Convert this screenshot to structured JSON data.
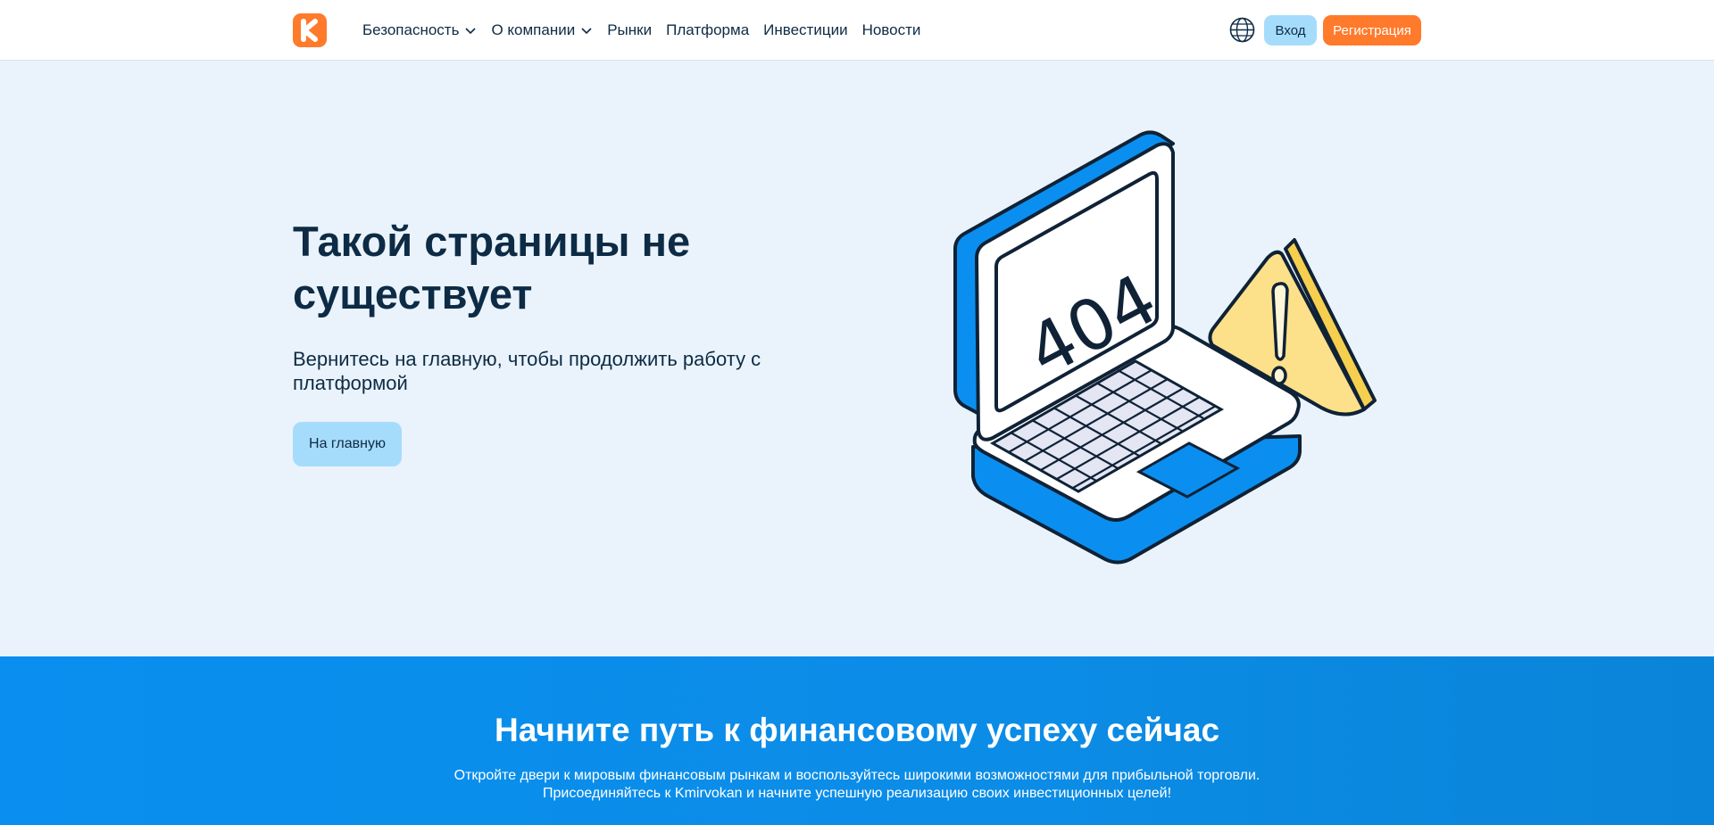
{
  "header": {
    "logo_icon": "brand-k-icon",
    "nav": [
      {
        "label": "Безопасность",
        "dropdown": true
      },
      {
        "label": "О компании",
        "dropdown": true
      },
      {
        "label": "Рынки",
        "dropdown": false
      },
      {
        "label": "Платформа",
        "dropdown": false
      },
      {
        "label": "Инвестиции",
        "dropdown": false
      },
      {
        "label": "Новости",
        "dropdown": false
      }
    ],
    "language_icon": "globe-icon",
    "login_label": "Вход",
    "register_label": "Регистрация"
  },
  "hero": {
    "title": "Такой страницы не существует",
    "subtitle": "Вернитесь на главную, чтобы продолжить работу с платформой",
    "home_button": "На главную",
    "illustration_text": "404"
  },
  "cta": {
    "title": "Начните путь к финансовому успеху сейчас",
    "line1": "Откройте двери к мировым финансовым рынкам и воспользуйтесь широкими возможностями для прибыльной торговли.",
    "line2": "Присоединяйтесь к Kmirvokan и начните успешную реализацию своих инвестиционных целей!"
  },
  "colors": {
    "brand_orange": "#ff7a2b",
    "light_blue_button": "#a6dcfb",
    "text_dark": "#0d2b45",
    "cta_blue": "#0a8ff0",
    "hero_bg": "#eaf3fb"
  }
}
